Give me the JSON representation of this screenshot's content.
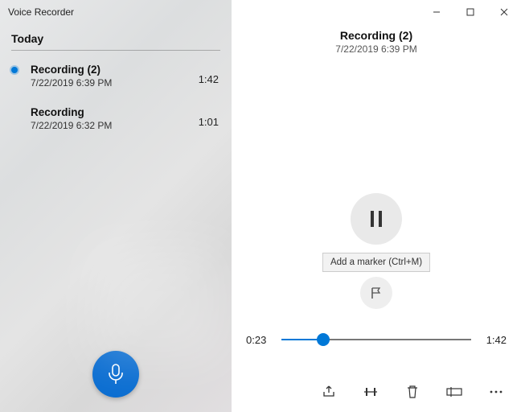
{
  "app": {
    "title": "Voice Recorder"
  },
  "window": {
    "minimize": "–",
    "maximize": "▢",
    "close": "✕"
  },
  "sidebar": {
    "section": "Today",
    "items": [
      {
        "name": "Recording (2)",
        "timestamp": "7/22/2019 6:39 PM",
        "duration": "1:42",
        "selected": true
      },
      {
        "name": "Recording",
        "timestamp": "7/22/2019 6:32 PM",
        "duration": "1:01",
        "selected": false
      }
    ]
  },
  "playback": {
    "name": "Recording (2)",
    "timestamp": "7/22/2019 6:39 PM",
    "tooltip": "Add a marker (Ctrl+M)",
    "position": "0:23",
    "duration": "1:42",
    "progress_percent": 22
  },
  "icons": {
    "record": "microphone-icon",
    "pause": "pause-icon",
    "flag": "flag-icon",
    "share": "share-icon",
    "trim": "trim-icon",
    "delete": "trash-icon",
    "rename": "rename-icon",
    "more": "more-icon"
  }
}
